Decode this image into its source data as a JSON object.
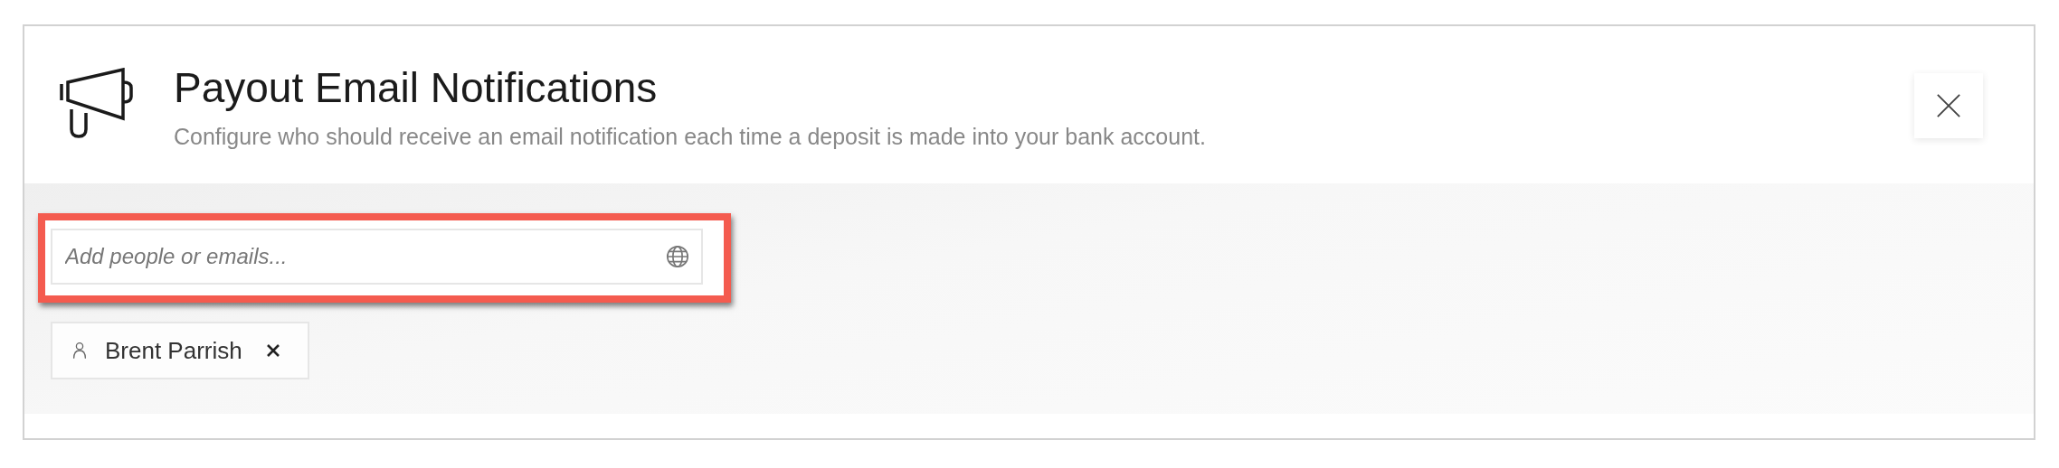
{
  "header": {
    "title": "Payout Email Notifications",
    "subtitle": "Configure who should receive an email notification each time a deposit is made into your bank account."
  },
  "search": {
    "placeholder": "Add people or emails..."
  },
  "recipients": [
    {
      "name": "Brent Parrish"
    }
  ]
}
